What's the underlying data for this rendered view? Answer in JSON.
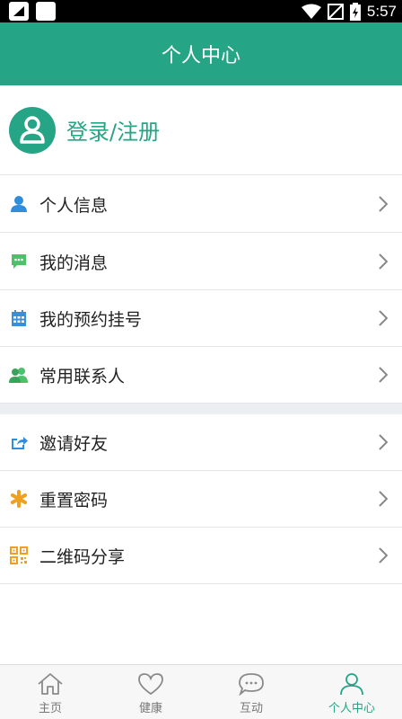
{
  "status_bar": {
    "time": "5:57"
  },
  "header": {
    "title": "个人中心"
  },
  "login": {
    "label": "登录/注册"
  },
  "menu_group1": [
    {
      "label": "个人信息",
      "icon": "person-icon",
      "color": "#2f8ddb"
    },
    {
      "label": "我的消息",
      "icon": "message-icon",
      "color": "#4cc16a"
    },
    {
      "label": "我的预约挂号",
      "icon": "calendar-icon",
      "color": "#3b8fd9"
    },
    {
      "label": "常用联系人",
      "icon": "contacts-icon",
      "color": "#4cc16a"
    }
  ],
  "menu_group2": [
    {
      "label": "邀请好友",
      "icon": "share-icon",
      "color": "#2f8ddb"
    },
    {
      "label": "重置密码",
      "icon": "asterisk-icon",
      "color": "#f0a020"
    },
    {
      "label": "二维码分享",
      "icon": "qrcode-icon",
      "color": "#f0a020"
    }
  ],
  "tabbar": [
    {
      "label": "主页",
      "icon": "home-icon",
      "active": false
    },
    {
      "label": "健康",
      "icon": "heart-icon",
      "active": false
    },
    {
      "label": "互动",
      "icon": "chat-icon",
      "active": false
    },
    {
      "label": "个人中心",
      "icon": "user-icon",
      "active": true
    }
  ],
  "colors": {
    "brand": "#26a586"
  }
}
